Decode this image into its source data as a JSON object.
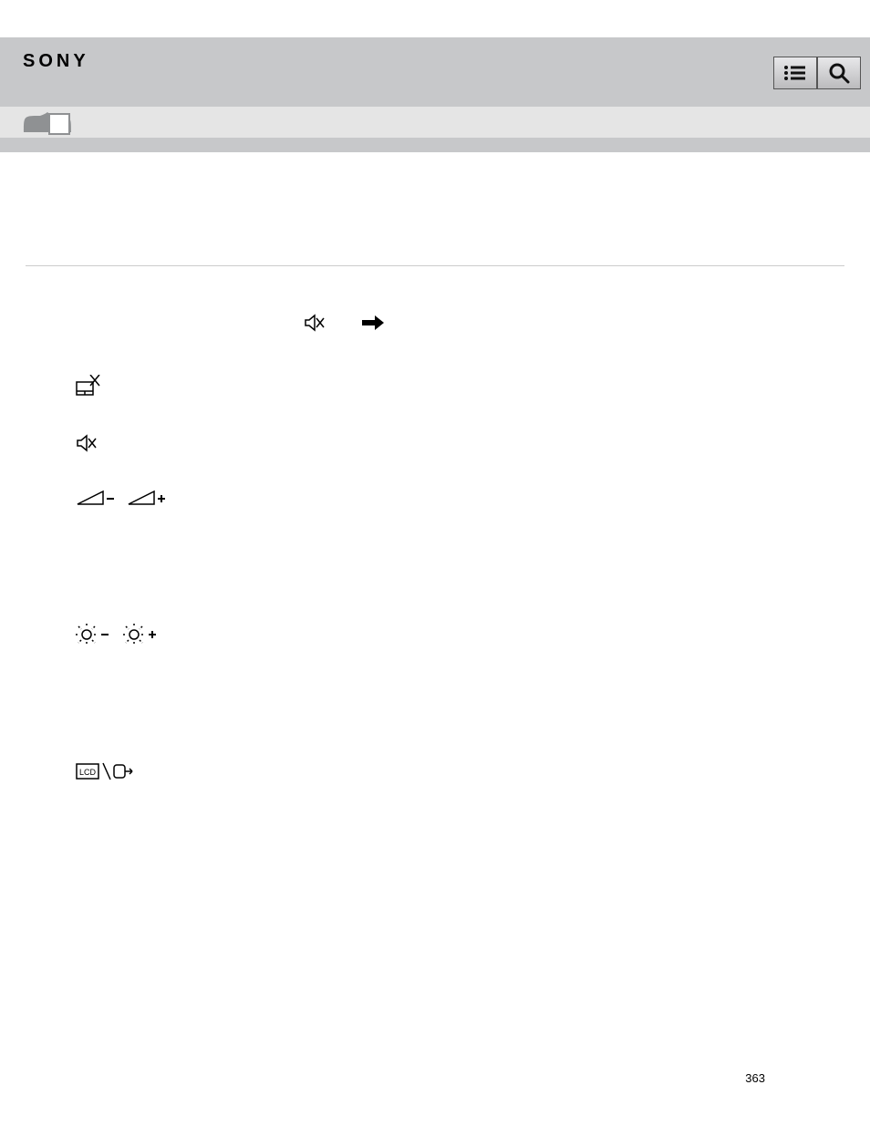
{
  "header": {
    "brand": "SONY"
  },
  "icons": {
    "row1_item1": "mute-speaker-icon",
    "row1_item2": "arrow-right-icon",
    "row2_item1": "touchpad-off-icon",
    "row3_item1": "mute-speaker-icon",
    "row4_item1": "volume-down-icon",
    "row4_item2": "volume-up-icon",
    "row5_item1": "brightness-down-icon",
    "row5_item2": "brightness-up-icon",
    "row6_item1": "lcd-output-toggle-icon"
  },
  "page_number": "363"
}
